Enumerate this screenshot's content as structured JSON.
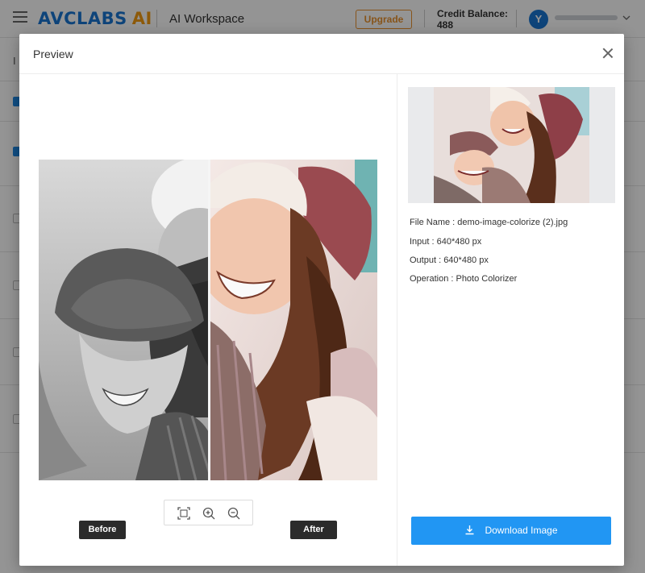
{
  "header": {
    "brand": "AVCLABS",
    "brand_suffix": "AI",
    "workspace": "AI Workspace",
    "upgrade_label": "Upgrade",
    "credit_label": "Credit Balance:",
    "credit_value": "488",
    "avatar_initial": "Y",
    "icons": [
      "menu-icon",
      "chevron-down-icon"
    ]
  },
  "background": {
    "column_label": "I"
  },
  "modal": {
    "title": "Preview",
    "before_label": "Before",
    "after_label": "After",
    "zoom_icons": [
      "fit-screen-icon",
      "zoom-in-icon",
      "zoom-out-icon"
    ],
    "info": {
      "file_name": "File Name : demo-image-colorize (2).jpg",
      "input": "Input : 640*480 px",
      "output": "Output : 640*480 px",
      "operation": "Operation : Photo Colorizer"
    },
    "download_label": "Download Image"
  },
  "colors": {
    "brand_blue": "#1976d2",
    "brand_orange": "#f39c12",
    "upgrade_orange": "#e8912d",
    "download_blue": "#2196f3",
    "tag_dark": "#2b2b2b"
  }
}
